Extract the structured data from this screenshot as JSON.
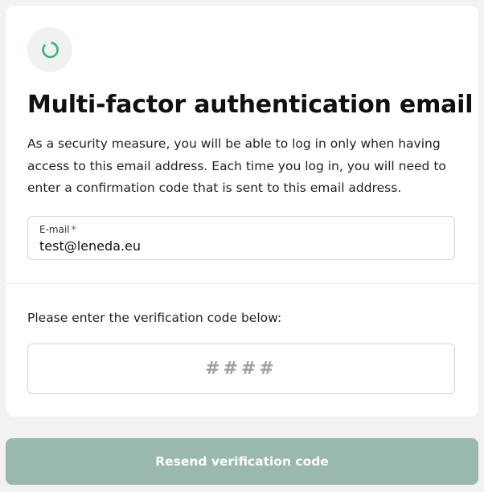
{
  "header": {
    "icon": "spinner-icon",
    "title": "Multi-factor authentication email"
  },
  "description": "As a security measure, you will be able to log in only when having access to this email address. Each time you log in, you will need to enter a confirmation code that is sent to this email address.",
  "email": {
    "label": "E-mail",
    "required_mark": "*",
    "value": "test@leneda.eu"
  },
  "verification": {
    "prompt": "Please enter the verification code below:",
    "placeholder": "####"
  },
  "resend_button": {
    "label": "Resend verification code"
  },
  "colors": {
    "accent": "#3fae7d",
    "button_background": "#9ab9ad",
    "icon_background": "#eef3f0",
    "page_background": "#f2f2f2",
    "required": "#d93025"
  }
}
